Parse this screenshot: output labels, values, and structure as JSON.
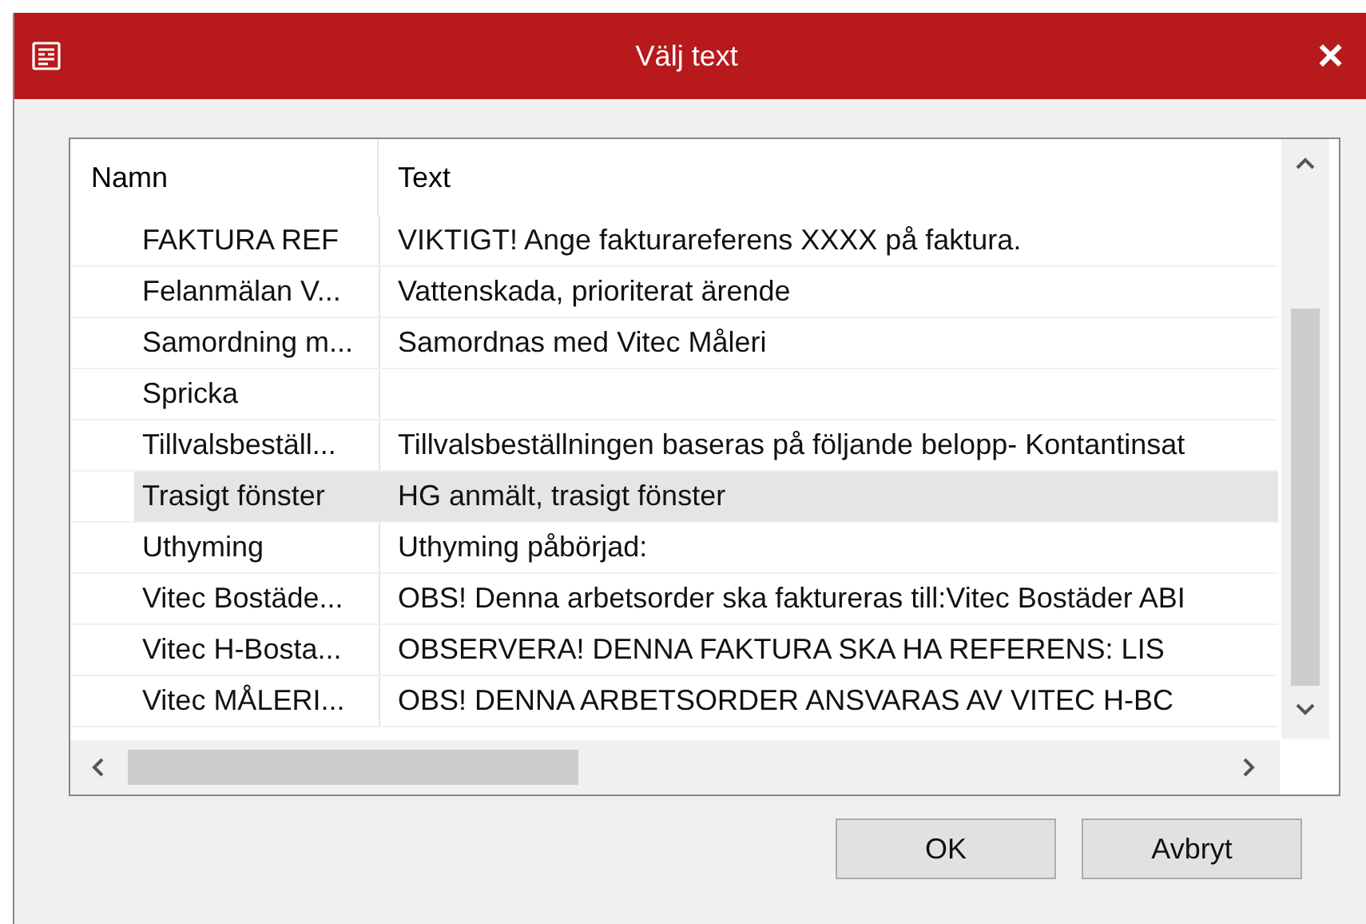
{
  "window": {
    "title": "Välj text",
    "close": "×"
  },
  "table": {
    "columns": [
      "Namn",
      "Text"
    ],
    "rows": [
      {
        "name": "FAKTURA REF",
        "text": "VIKTIGT! Ange fakturareferens XXXX på faktura.",
        "selected": false
      },
      {
        "name": "Felanmälan V...",
        "text": "Vattenskada, prioriterat ärende",
        "selected": false
      },
      {
        "name": "Samordning m...",
        "text": "Samordnas med Vitec Måleri",
        "selected": false
      },
      {
        "name": "Spricka",
        "text": "",
        "selected": false
      },
      {
        "name": "Tillvalsbeställ...",
        "text": "Tillvalsbeställningen baseras på följande belopp- Kontantinsat",
        "selected": false
      },
      {
        "name": "Trasigt fönster",
        "text": "HG anmält, trasigt fönster",
        "selected": true
      },
      {
        "name": "Uthyming",
        "text": "Uthyming påbörjad:",
        "selected": false
      },
      {
        "name": "Vitec Bostäde...",
        "text": "OBS! Denna arbetsorder ska faktureras till:Vitec Bostäder ABI",
        "selected": false
      },
      {
        "name": "Vitec H-Bosta...",
        "text": "OBSERVERA! DENNA FAKTURA SKA HA REFERENS: LIS",
        "selected": false
      },
      {
        "name": "Vitec MÅLERI...",
        "text": "OBS! DENNA ARBETSORDER ANSVARAS AV VITEC H-BC",
        "selected": false
      }
    ]
  },
  "buttons": [
    "OK",
    "Avbryt"
  ]
}
